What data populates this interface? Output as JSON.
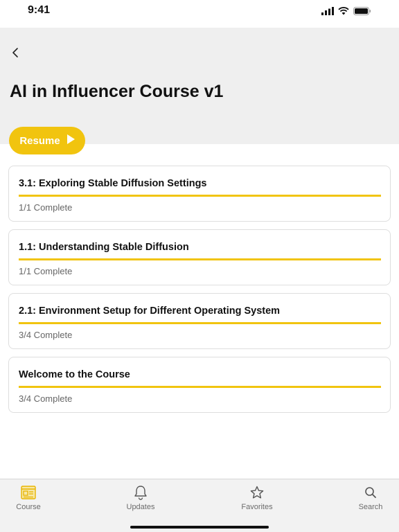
{
  "status_bar": {
    "time": "9:41",
    "icons": [
      "signal-icon",
      "wifi-icon",
      "battery-icon"
    ]
  },
  "header": {
    "back_icon": "chevron-left-icon",
    "title": "AI in Influencer Course v1"
  },
  "resume_button": {
    "label": "Resume",
    "icon": "play-icon",
    "color": "#f1c40f"
  },
  "lessons": [
    {
      "title": "3.1: Exploring Stable Diffusion Settings",
      "status": "1/1 Complete",
      "progress": 1.0
    },
    {
      "title": "1.1: Understanding Stable Diffusion",
      "status": "1/1 Complete",
      "progress": 1.0
    },
    {
      "title": "2.1: Environment Setup for Different Operating System",
      "status": "3/4 Complete",
      "progress": 1.0
    },
    {
      "title": "Welcome to the Course",
      "status": "3/4 Complete",
      "progress": 1.0
    }
  ],
  "tab_bar": {
    "active_tab": "course",
    "accent_color": "#f1c40f",
    "tabs": [
      {
        "id": "course",
        "label": "Course",
        "icon": "course-icon"
      },
      {
        "id": "updates",
        "label": "Updates",
        "icon": "bell-icon"
      },
      {
        "id": "favorites",
        "label": "Favorites",
        "icon": "star-icon"
      },
      {
        "id": "search",
        "label": "Search",
        "icon": "search-icon"
      }
    ]
  }
}
